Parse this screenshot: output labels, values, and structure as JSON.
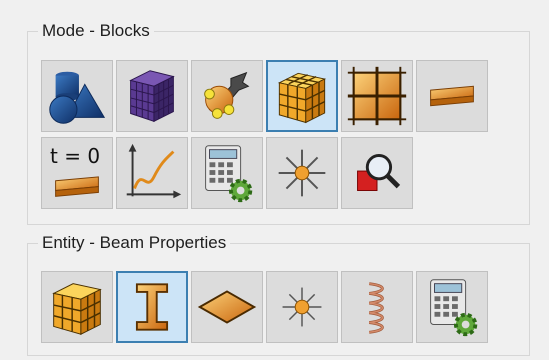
{
  "modes_group": {
    "title": "Mode - Blocks",
    "buttons": [
      {
        "icon": "geometry-primitives-icon",
        "selected": false
      },
      {
        "icon": "mesh-cube-purple-icon",
        "selected": false
      },
      {
        "icon": "geometry-tools-wrench-icon",
        "selected": false
      },
      {
        "icon": "blocks-cube-icon",
        "selected": true
      },
      {
        "icon": "block-grid-icon",
        "selected": false
      },
      {
        "icon": "edge-curve-icon",
        "selected": false
      },
      {
        "icon": "initial-time-icon",
        "label": "t = 0",
        "selected": false
      },
      {
        "icon": "graph-curve-icon",
        "selected": false
      },
      {
        "icon": "calculator-settings-icon",
        "selected": false
      },
      {
        "icon": "point-sparkle-icon",
        "selected": false
      },
      {
        "icon": "zoom-inspect-icon",
        "selected": false
      }
    ]
  },
  "entity_group": {
    "title": "Entity - Beam Properties",
    "buttons": [
      {
        "icon": "block-cube-icon",
        "selected": false
      },
      {
        "icon": "beam-i-section-icon",
        "selected": true
      },
      {
        "icon": "shell-plate-icon",
        "selected": false
      },
      {
        "icon": "point-node-icon",
        "selected": false
      },
      {
        "icon": "spring-coil-icon",
        "selected": false
      },
      {
        "icon": "calculator-settings-icon",
        "selected": false
      }
    ]
  },
  "colors": {
    "accent_selected_border": "#3c7fb1",
    "selected_background": "#cce4f7",
    "button_background": "#dcdcdc",
    "orange": "#e48a1a",
    "gold": "#f2b632",
    "blue": "#1f4e8c",
    "purple": "#4a2c7a"
  }
}
